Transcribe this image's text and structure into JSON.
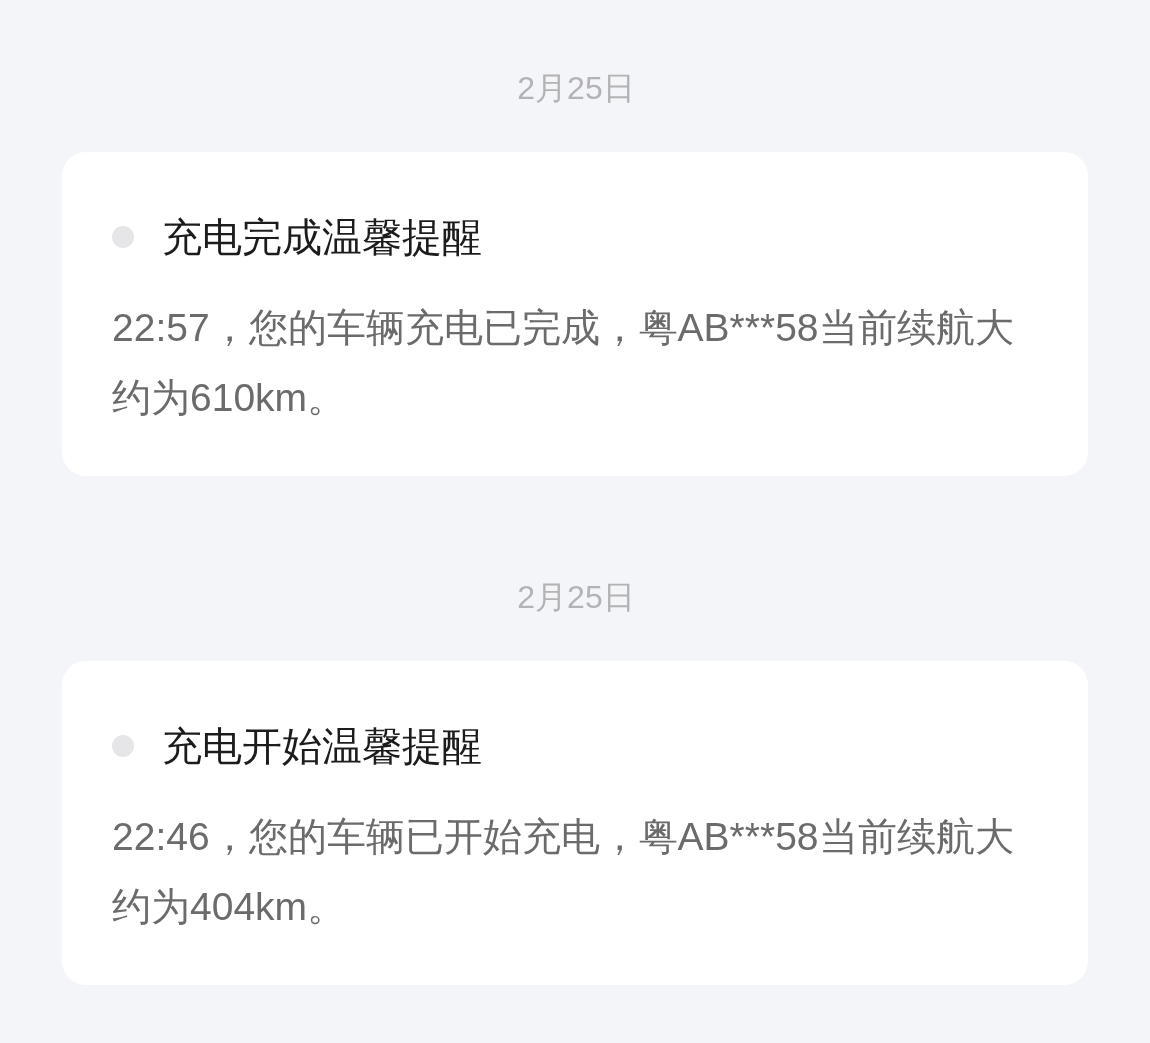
{
  "messages": [
    {
      "date": "2月25日",
      "title": "充电完成温馨提醒",
      "body": "22:57，您的车辆充电已完成，粤AB***58当前续航大约为610km。"
    },
    {
      "date": "2月25日",
      "title": "充电开始温馨提醒",
      "body": "22:46，您的车辆已开始充电，粤AB***58当前续航大约为404km。"
    }
  ]
}
